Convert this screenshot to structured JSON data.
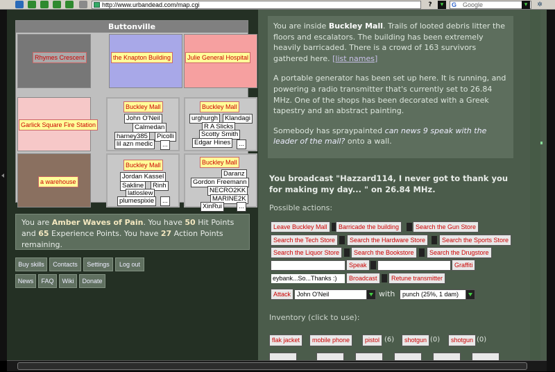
{
  "browser": {
    "url": "http://www.urbandead.com/map.cgi",
    "search_placeholder": "Google"
  },
  "map": {
    "title": "Buttonville",
    "cells": [
      {
        "label": "Rhymes Crescent"
      },
      {
        "label": "the Knapton Building"
      },
      {
        "label": "Julie General Hospital"
      },
      {
        "label": "Garlick Square Fire Station"
      },
      {
        "label": "Buckley Mall",
        "names": [
          "John O'Neil",
          "Calmedan",
          "harney385",
          "Picolli",
          "lil azn medic",
          "..."
        ]
      },
      {
        "label": "Buckley Mall",
        "names": [
          "urghurgh",
          "Klandagi",
          "R A Slicks",
          "Scotty Smith",
          "Edgar Hines",
          "..."
        ]
      },
      {
        "label": "a warehouse"
      },
      {
        "label": "Buckley Mall",
        "names": [
          "Jordan Kassel",
          "Sakline",
          "Rinh",
          "latloslew",
          "plumespixie",
          "..."
        ]
      },
      {
        "label": "Buckley Mall",
        "names": [
          "Daranz",
          "Gordon Freemann",
          "NECRO2KK",
          "MARINE2K",
          "XinRui",
          "..."
        ]
      }
    ]
  },
  "status": {
    "prefix": "You are ",
    "name": "Amber Waves of Pain",
    "mid1": ". You have ",
    "hp": "50",
    "mid2": " Hit Points and ",
    "xp": "65",
    "mid3": " Experience Points. You have ",
    "ap": "27",
    "mid4": " Action Points remaining."
  },
  "nav": [
    "Buy skills",
    "Contacts",
    "Settings",
    "Log out",
    "News",
    "FAQ",
    "Wiki",
    "Donate"
  ],
  "description": {
    "p1_pre": "You are inside ",
    "p1_place": "Buckley Mall",
    "p1_post": ". Trails of looted debris litter the floors and escalators. The building has been extremely heavily barricaded. There is a crowd of 163 survivors gathered here. ",
    "p1_link": "[list names]",
    "p2": "A portable generator has been set up here. It is running, and powering a radio transmitter that's currently set to 26.84 MHz. One of the shops has been decorated with a Greek tapestry and an abstract painting.",
    "p3_pre": "Somebody has spraypainted ",
    "p3_graffiti": "can news 9 speak with the leader of the mall?",
    "p3_post": " onto a wall."
  },
  "broadcast_msg": "You broadcast \"Hazzard114, I never got to thank you for making my day... \" on 26.84 MHz.",
  "possible_actions_label": "Possible actions:",
  "actions": {
    "leave": "Leave Buckley Mall",
    "barricade": "Barricade the building",
    "gun": "Search the Gun Store",
    "tech": "Search the Tech Store",
    "hardware": "Search the Hardware Store",
    "sports": "Search the Sports Store",
    "liquor": "Search the Liquor Store",
    "book": "Search the Bookstore",
    "drug": "Search the Drugstore",
    "speak": "Speak",
    "graffiti": "Graffiti",
    "broadcast_value": "eybank...So...Thanks :)",
    "broadcast": "Broadcast",
    "retune": "Retune transmitter",
    "attack": "Attack",
    "attack_target": "John O'Neil",
    "with": "with",
    "weapon": "punch (25%, 1 dam)"
  },
  "inventory_label": "Inventory (click to use):",
  "inventory": [
    {
      "name": "flak jacket",
      "count": ""
    },
    {
      "name": "mobile phone",
      "count": ""
    },
    {
      "name": "pistol",
      "count": "(6)"
    },
    {
      "name": "shotgun",
      "count": "(0)"
    },
    {
      "name": "shotgun",
      "count": "(0)"
    }
  ]
}
